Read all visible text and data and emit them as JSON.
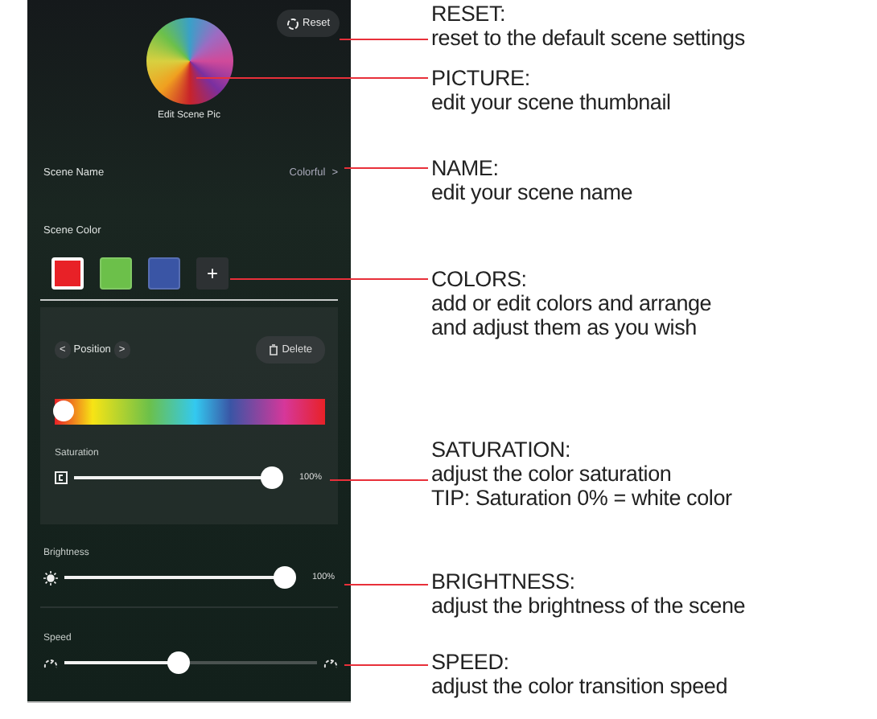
{
  "scene": {
    "reset_button": "Reset",
    "picture_caption": "Edit Scene Pic",
    "name_label": "Scene Name",
    "name_value": "Colorful",
    "name_chevron": ">",
    "color_label": "Scene Color",
    "colors": [
      {
        "color": "#e82127",
        "selected": true
      },
      {
        "color": "#6cc04a",
        "selected": false
      },
      {
        "color": "#3a55a5",
        "selected": false
      }
    ],
    "add_button": "+",
    "position": {
      "prev": "<",
      "label": "Position",
      "next": ">"
    },
    "delete_button": "Delete",
    "hue": {
      "level": 0
    },
    "sliders": [
      {
        "kind": "saturation",
        "label": "Saturation",
        "level": 1,
        "reading": "100%"
      },
      {
        "kind": "brightness",
        "label": "Brightness",
        "level": 1,
        "reading": "100%"
      },
      {
        "kind": "speed",
        "label": "Speed",
        "level": 0.45
      }
    ]
  },
  "callouts": [
    {
      "heading": "RESET:",
      "description": "reset to the default scene settings"
    },
    {
      "heading": "PICTURE:",
      "description": "edit your scene thumbnail"
    },
    {
      "heading": "NAME:",
      "description": "edit your scene name"
    },
    {
      "heading": "COLORS:",
      "description": "add or edit colors and arrange\nand adjust them as you wish"
    },
    {
      "heading": "SATURATION:",
      "description": "adjust the color saturation",
      "tip": "TIP:  Saturation 0% = white color"
    },
    {
      "heading": "BRIGHTNESS:",
      "description": "adjust the brightness of the scene"
    },
    {
      "heading": "SPEED:",
      "description": "adjust the color transition speed"
    }
  ]
}
